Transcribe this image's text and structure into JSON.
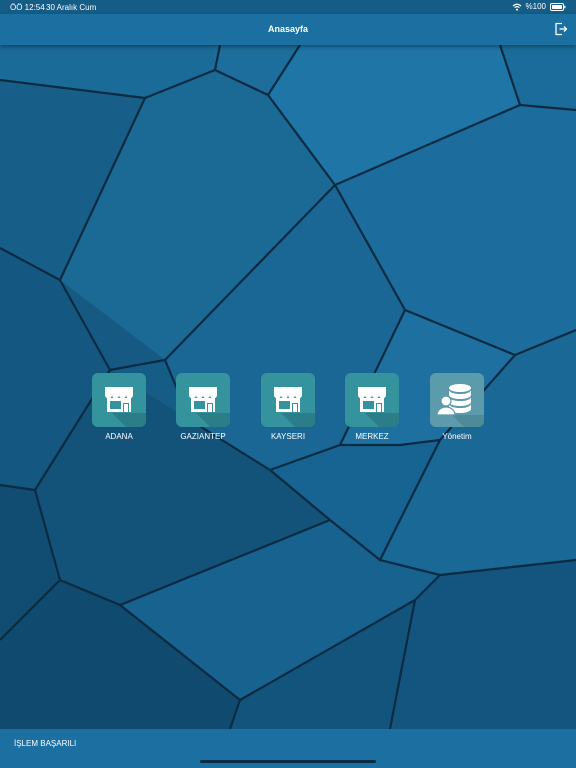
{
  "status_bar": {
    "time": "ÖÖ 12:54",
    "date": "30 Aralık Cum",
    "battery": "%100",
    "icons": [
      "wifi-icon",
      "battery-icon"
    ]
  },
  "nav": {
    "title": "Anasayfa",
    "logout_icon": "logout-icon"
  },
  "tiles": [
    {
      "label": "ADANA",
      "icon": "store-icon"
    },
    {
      "label": "GAZIANTEP",
      "icon": "store-icon"
    },
    {
      "label": "KAYSERI",
      "icon": "store-icon"
    },
    {
      "label": "MERKEZ",
      "icon": "store-icon"
    },
    {
      "label": "Yönetim",
      "icon": "database-user-icon"
    }
  ],
  "bottom_bar": {
    "message": "İŞLEM BAŞARILI"
  },
  "colors": {
    "bar": "#1b6fa1",
    "background": "#155d87",
    "store_tile": "#35939d",
    "admin_tile": "#5b9bab"
  }
}
